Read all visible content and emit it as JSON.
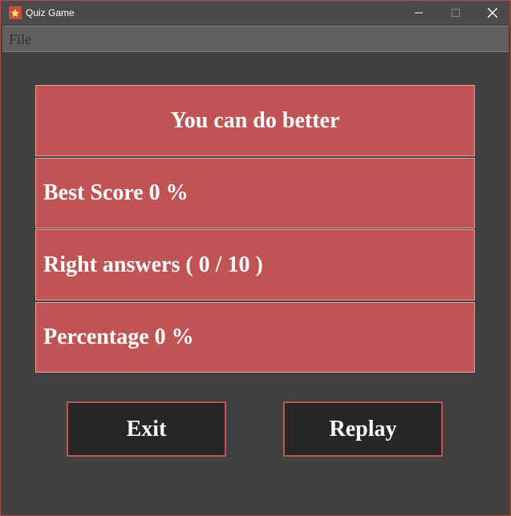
{
  "window": {
    "title": "Quiz Game",
    "minimize_icon": "minimize-icon",
    "maximize_icon": "maximize-icon",
    "close_icon": "close-icon"
  },
  "menu": {
    "file": "File"
  },
  "results": {
    "heading": "You can do better",
    "best_score": "Best Score  0 %",
    "right_answers": "Right answers  ( 0 / 10 )",
    "percentage": "Percentage 0 %"
  },
  "buttons": {
    "exit": "Exit",
    "replay": "Replay"
  },
  "colors": {
    "panel": "#c05353",
    "background": "#414141",
    "button": "#262626"
  }
}
